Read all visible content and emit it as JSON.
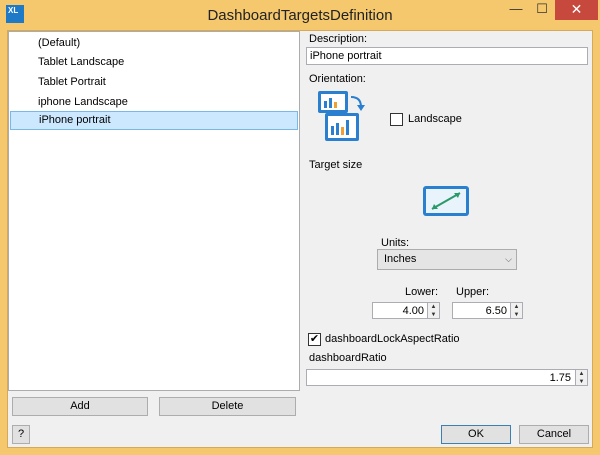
{
  "window": {
    "title": "DashboardTargetsDefinition",
    "app_icon_text": "XL",
    "close_glyph": "✕",
    "min_glyph": "—",
    "max_glyph": "☐"
  },
  "list": {
    "items": [
      {
        "label": "(Default)"
      },
      {
        "label": "Tablet Landscape"
      },
      {
        "label": "Tablet Portrait"
      },
      {
        "label": "iphone Landscape"
      },
      {
        "label": "iPhone portrait",
        "selected": true
      }
    ]
  },
  "buttons": {
    "add": "Add",
    "delete": "Delete",
    "help": "?",
    "ok": "OK",
    "cancel": "Cancel"
  },
  "form": {
    "description_label": "Description:",
    "description_value": "iPhone portrait",
    "orientation_label": "Orientation:",
    "landscape_label": "Landscape",
    "landscape_checked": false,
    "target_size_label": "Target size",
    "units_label": "Units:",
    "units_value": "Inches",
    "lower_label": "Lower:",
    "upper_label": "Upper:",
    "lower_value": "4.00",
    "upper_value": "6.50",
    "lock_label": "dashboardLockAspectRatio",
    "lock_checked": true,
    "check_glyph": "✔",
    "ratio_label": "dashboardRatio",
    "ratio_value": "1.75"
  },
  "icons": {
    "orientation": "orientation-icon",
    "target_size": "target-size-icon",
    "dropdown": "chevron-down-icon",
    "spin_up": "spin-up-icon",
    "spin_down": "spin-down-icon"
  },
  "colors": {
    "titlebar": "#f5c86e",
    "selection": "#cce8ff",
    "accent": "#1e79c7",
    "close": "#c7493d"
  }
}
